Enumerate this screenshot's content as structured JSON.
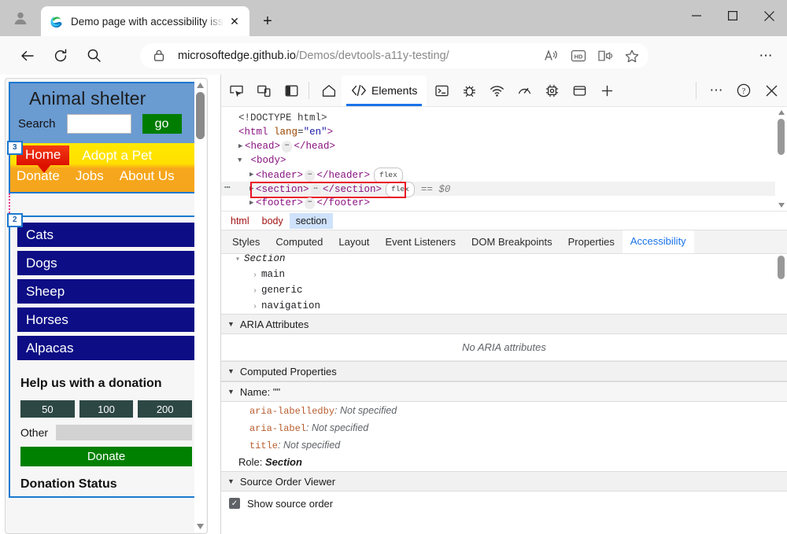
{
  "browser": {
    "tab": {
      "title": "Demo page with accessibility issu",
      "favicon": "edge-logo-icon",
      "close": "✕"
    },
    "new_tab_label": "+",
    "window_controls": {
      "minimize": "–",
      "maximize": "□",
      "close": "✕"
    },
    "nav": {
      "back": "←",
      "refresh": "⟳",
      "search": "search-icon"
    },
    "omnibox": {
      "url_bold": "microsoftedge.github.io",
      "url_rest": "/Demos/devtools-a11y-testing/",
      "lock": "lock-icon",
      "actions": [
        "read-aloud-icon",
        "hd-icon",
        "immersive-reader-icon",
        "favorite-star-icon"
      ]
    },
    "more_label": "⋯"
  },
  "page": {
    "title": "Animal shelter",
    "search_label": "Search",
    "search_value": "",
    "go_label": "go",
    "nav_badge": "3",
    "nav_row1": [
      "Home",
      "Adopt a Pet"
    ],
    "nav_row2": [
      "Donate",
      "Jobs",
      "About Us"
    ],
    "list_badge": "2",
    "categories": [
      "Cats",
      "Dogs",
      "Sheep",
      "Horses",
      "Alpacas"
    ],
    "donation": {
      "heading": "Help us with a donation",
      "amounts": [
        "50",
        "100",
        "200"
      ],
      "other_label": "Other",
      "other_value": "",
      "submit_label": "Donate"
    },
    "status_heading": "Donation Status"
  },
  "devtools": {
    "toolbar": {
      "left_icons": [
        "inspect-element-icon",
        "device-toolbar-icon",
        "dock-side-icon"
      ],
      "home_icon": "home-icon",
      "tabs": [
        {
          "label": "Elements",
          "icon": "code-brackets-icon",
          "active": true
        }
      ],
      "right_icons": [
        "console-icon",
        "sources-debug-icon",
        "network-icon",
        "performance-icon",
        "memory-icon",
        "application-icon",
        "more-tools-plus-icon"
      ],
      "overflow": "⋯",
      "help": "?",
      "close": "✕"
    },
    "dom": {
      "lines": [
        {
          "indent": 0,
          "text": "<!DOCTYPE html>"
        },
        {
          "indent": 0,
          "text": "<html lang=\"en\">"
        },
        {
          "indent": 1,
          "text": "<head> … </head>"
        },
        {
          "indent": 1,
          "text": "<body>"
        },
        {
          "indent": 2,
          "text": "<header> … </header>"
        },
        {
          "indent": 2,
          "text": "<section> … </section>"
        },
        {
          "indent": 2,
          "text": "<footer> … </footer>"
        }
      ],
      "doctype": "<!DOCTYPE html>",
      "html_tag": "html",
      "html_attr": "lang",
      "html_attr_value": "\"en\"",
      "head_tag": "head",
      "body_tag": "body",
      "header_tag": "header",
      "section_tag": "section",
      "footer_tag": "footer",
      "flex_badge": "flex",
      "selected_ref": "== $0"
    },
    "breadcrumbs": [
      {
        "label": "html",
        "active": false
      },
      {
        "label": "body",
        "active": false
      },
      {
        "label": "section",
        "active": true
      }
    ],
    "subtabs": [
      {
        "label": "Styles",
        "active": false
      },
      {
        "label": "Computed",
        "active": false
      },
      {
        "label": "Layout",
        "active": false
      },
      {
        "label": "Event Listeners",
        "active": false
      },
      {
        "label": "DOM Breakpoints",
        "active": false
      },
      {
        "label": "Properties",
        "active": false
      },
      {
        "label": "Accessibility",
        "active": true
      }
    ],
    "accessibility": {
      "tree_root": "Section",
      "tree_children": [
        "main",
        "generic",
        "navigation"
      ],
      "aria_section_title": "ARIA Attributes",
      "no_aria_text": "No ARIA attributes",
      "computed_section_title": "Computed Properties",
      "name_row": "Name: \"\"",
      "properties": [
        {
          "key": "aria-labelledby",
          "value": "Not specified"
        },
        {
          "key": "aria-label",
          "value": "Not specified"
        },
        {
          "key": "title",
          "value": "Not specified"
        }
      ],
      "role_label": "Role:",
      "role_value": "Section",
      "source_order_title": "Source Order Viewer",
      "show_source_order_label": "Show source order",
      "show_source_order_checked": true,
      "checkmark": "✓"
    }
  }
}
